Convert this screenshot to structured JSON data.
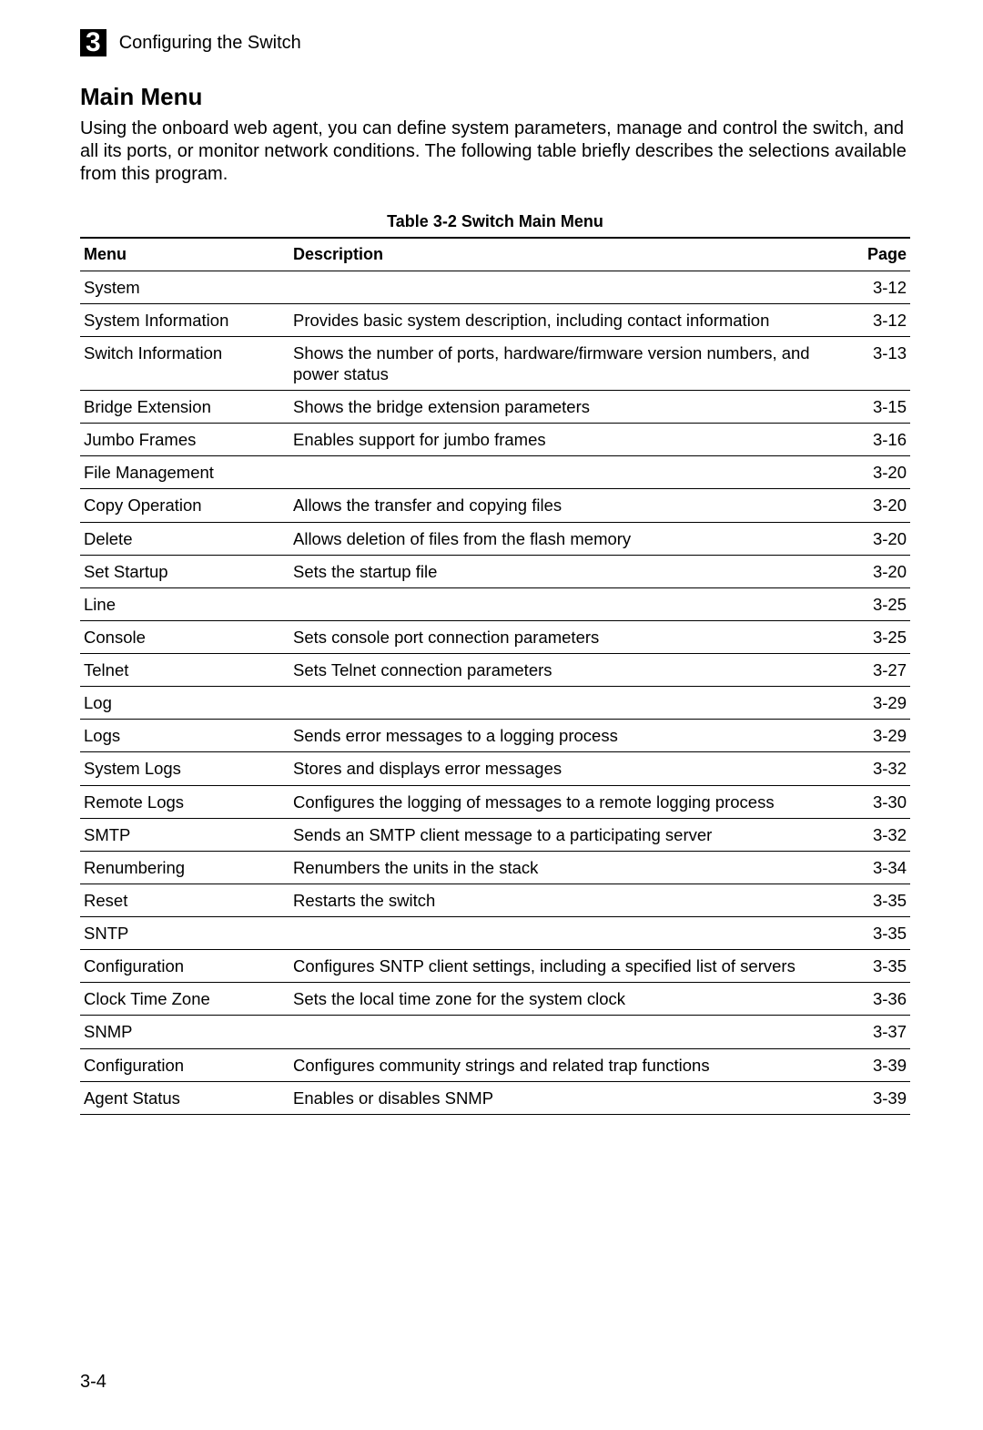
{
  "header": {
    "chapter_number": "3",
    "chapter_title": "Configuring the Switch"
  },
  "section": {
    "title": "Main Menu",
    "intro": "Using the onboard web agent, you can define system parameters, manage and control the switch, and all its ports, or monitor network conditions. The following table briefly describes the selections available from this program."
  },
  "table": {
    "caption": "Table 3-2   Switch Main Menu",
    "columns": {
      "menu": "Menu",
      "description": "Description",
      "page": "Page"
    },
    "rows": [
      {
        "menu": "System",
        "indent": 0,
        "description": "",
        "page": "3-12"
      },
      {
        "menu": "System Information",
        "indent": 1,
        "description": "Provides basic system description, including contact information",
        "page": "3-12"
      },
      {
        "menu": "Switch Information",
        "indent": 1,
        "description": "Shows the number of ports, hardware/firmware version numbers, and power status",
        "page": "3-13"
      },
      {
        "menu": "Bridge Extension",
        "indent": 1,
        "description": "Shows the bridge extension parameters",
        "page": "3-15"
      },
      {
        "menu": "Jumbo Frames",
        "indent": 1,
        "description": "Enables support for jumbo frames",
        "page": "3-16"
      },
      {
        "menu": "File Management",
        "indent": 1,
        "description": "",
        "page": "3-20"
      },
      {
        "menu": "Copy Operation",
        "indent": 2,
        "description": "Allows the transfer and copying files",
        "page": "3-20"
      },
      {
        "menu": "Delete",
        "indent": 2,
        "description": "Allows deletion of files from the flash memory",
        "page": "3-20"
      },
      {
        "menu": "Set Startup",
        "indent": 2,
        "description": "Sets the startup file",
        "page": "3-20"
      },
      {
        "menu": "Line",
        "indent": 1,
        "description": "",
        "page": "3-25"
      },
      {
        "menu": "Console",
        "indent": 2,
        "description": "Sets console port connection parameters",
        "page": "3-25"
      },
      {
        "menu": "Telnet",
        "indent": 2,
        "description": "Sets Telnet connection parameters",
        "page": "3-27"
      },
      {
        "menu": "Log",
        "indent": 1,
        "description": "",
        "page": "3-29"
      },
      {
        "menu": "Logs",
        "indent": 2,
        "description": "Sends error messages to a logging process",
        "page": "3-29"
      },
      {
        "menu": "System Logs",
        "indent": 2,
        "description": "Stores and displays error messages",
        "page": "3-32"
      },
      {
        "menu": "Remote Logs",
        "indent": 2,
        "description": "Configures the logging of messages to a remote logging process",
        "page": "3-30"
      },
      {
        "menu": "SMTP",
        "indent": 2,
        "description": "Sends an SMTP client message to a participating server",
        "page": "3-32"
      },
      {
        "menu": "Renumbering",
        "indent": 1,
        "description": "Renumbers the units in the stack",
        "page": "3-34"
      },
      {
        "menu": "Reset",
        "indent": 1,
        "description": "Restarts the switch",
        "page": "3-35"
      },
      {
        "menu": "SNTP",
        "indent": 0,
        "description": "",
        "page": "3-35"
      },
      {
        "menu": "Configuration",
        "indent": 1,
        "description": "Configures SNTP client settings, including a specified list of servers",
        "page": "3-35"
      },
      {
        "menu": "Clock Time Zone",
        "indent": 1,
        "description": "Sets the local time zone for the system clock",
        "page": "3-36"
      },
      {
        "menu": "SNMP",
        "indent": 0,
        "description": "",
        "page": "3-37"
      },
      {
        "menu": "Configuration",
        "indent": 1,
        "description": "Configures community strings and related trap functions",
        "page": "3-39"
      },
      {
        "menu": "Agent Status",
        "indent": 1,
        "description": "Enables or disables SNMP",
        "page": "3-39"
      }
    ]
  },
  "footer": {
    "page_number": "3-4"
  }
}
